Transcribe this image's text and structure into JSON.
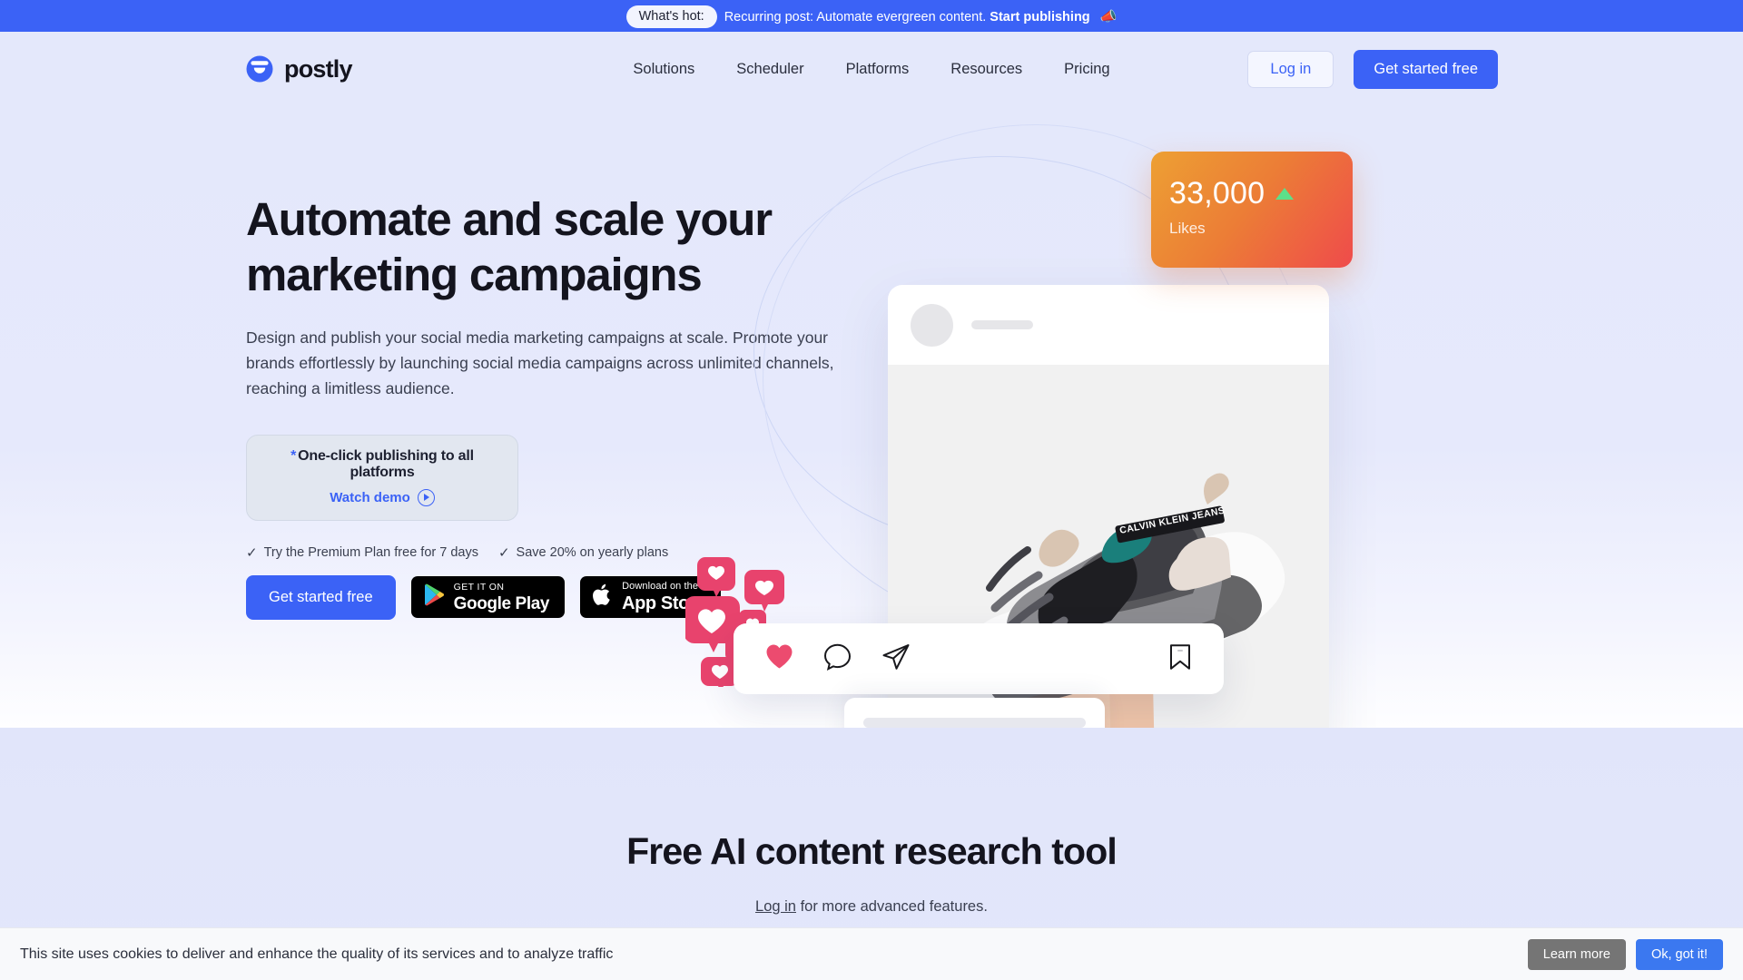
{
  "announcement": {
    "pill_label": "What's hot:",
    "message": "Recurring post: Automate evergreen content.",
    "link_label": "Start publishing",
    "emoji": "📣"
  },
  "header": {
    "brand_name": "postly",
    "nav": [
      {
        "label": "Solutions"
      },
      {
        "label": "Scheduler"
      },
      {
        "label": "Platforms"
      },
      {
        "label": "Resources"
      },
      {
        "label": "Pricing"
      }
    ],
    "login_label": "Log in",
    "cta_label": "Get started free"
  },
  "hero": {
    "title": "Automate and scale your marketing campaigns",
    "subtitle": "Design and publish your social media marketing campaigns at scale. Promote your brands effortlessly by launching social media campaigns across unlimited channels, reaching a limitless audience.",
    "demo_card": {
      "star": "*",
      "headline": "One-click publishing to all platforms",
      "watch_label": "Watch demo"
    },
    "perks": [
      {
        "tick": "✓",
        "label": "Try the Premium Plan free for 7 days"
      },
      {
        "tick": "✓",
        "label": "Save 20% on yearly plans"
      }
    ],
    "cta_label": "Get started free",
    "google_play": {
      "top": "GET IT ON",
      "bottom": "Google Play"
    },
    "app_store": {
      "top": "Download on the",
      "bottom": "App Store"
    },
    "stat_card": {
      "value": "33,000",
      "label": "Likes",
      "trend": "up"
    }
  },
  "lower_section": {
    "title": "Free AI content research tool",
    "link_label": "Log in",
    "subtitle_rest": " for more advanced features."
  },
  "cookie_bar": {
    "message": "This site uses cookies to deliver and enhance the quality of its services and to analyze traffic",
    "learn_label": "Learn more",
    "accept_label": "Ok, got it!"
  },
  "colors": {
    "brand_blue": "#3b62f6",
    "hero_bg": "#e4e8fb",
    "stat_gradient_start": "#eda033",
    "stat_gradient_end": "#ef4b4b",
    "trend_green": "#5ce08a",
    "heart_pink": "#e8436d",
    "cookie_accept": "#3b78f0",
    "cookie_learn": "#757575"
  }
}
